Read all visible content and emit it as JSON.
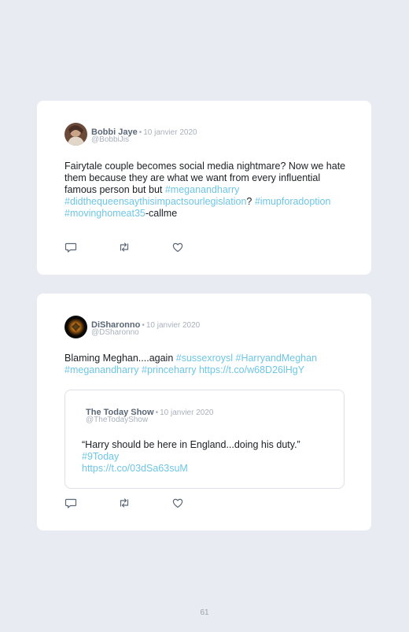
{
  "posts": [
    {
      "author": "Bobbi Jaye",
      "date": "10 janvier 2020",
      "handle": "@BobbiJis",
      "separator": "•",
      "text_parts": {
        "a": "Fairytale couple becomes social media nightmare? Now we hate them because they are what we want from every influential famous person but but ",
        "b": "#meganandharry",
        "c": "#didthequeensaythisimpactsourlegislation",
        "d": "?",
        "e": "#imupforadoption",
        "f": "#movinghomeat35",
        "g": "-callme"
      }
    },
    {
      "author": "DiSharonno",
      "date": "10 janvier 2020",
      "handle": "@DSharonno",
      "separator": "•",
      "text_parts": {
        "a": "Blaming Meghan....again ",
        "b": "#sussexroysl",
        "c": "#HarryandMeghan",
        "d": "#meganandharry",
        "e": "#princeharry",
        "f": "https://t.co/w68D26lHgY"
      },
      "quote": {
        "author": "The Today Show",
        "date": "10 janvier 2020",
        "handle": "@TheTodayShow",
        "separator": "•",
        "text": "“Harry should be here in England...doing his duty.”",
        "tag": "#9Today",
        "link": "https://t.co/03dSa63suM"
      }
    }
  ],
  "icons": [
    "reply-icon",
    "retweet-icon",
    "like-icon"
  ],
  "colors": {
    "background": "#e8ebf2",
    "card": "#ffffff",
    "link": "#6ec6e6",
    "name": "#5b6776",
    "muted": "#a9b1bb"
  },
  "page_number": "61"
}
